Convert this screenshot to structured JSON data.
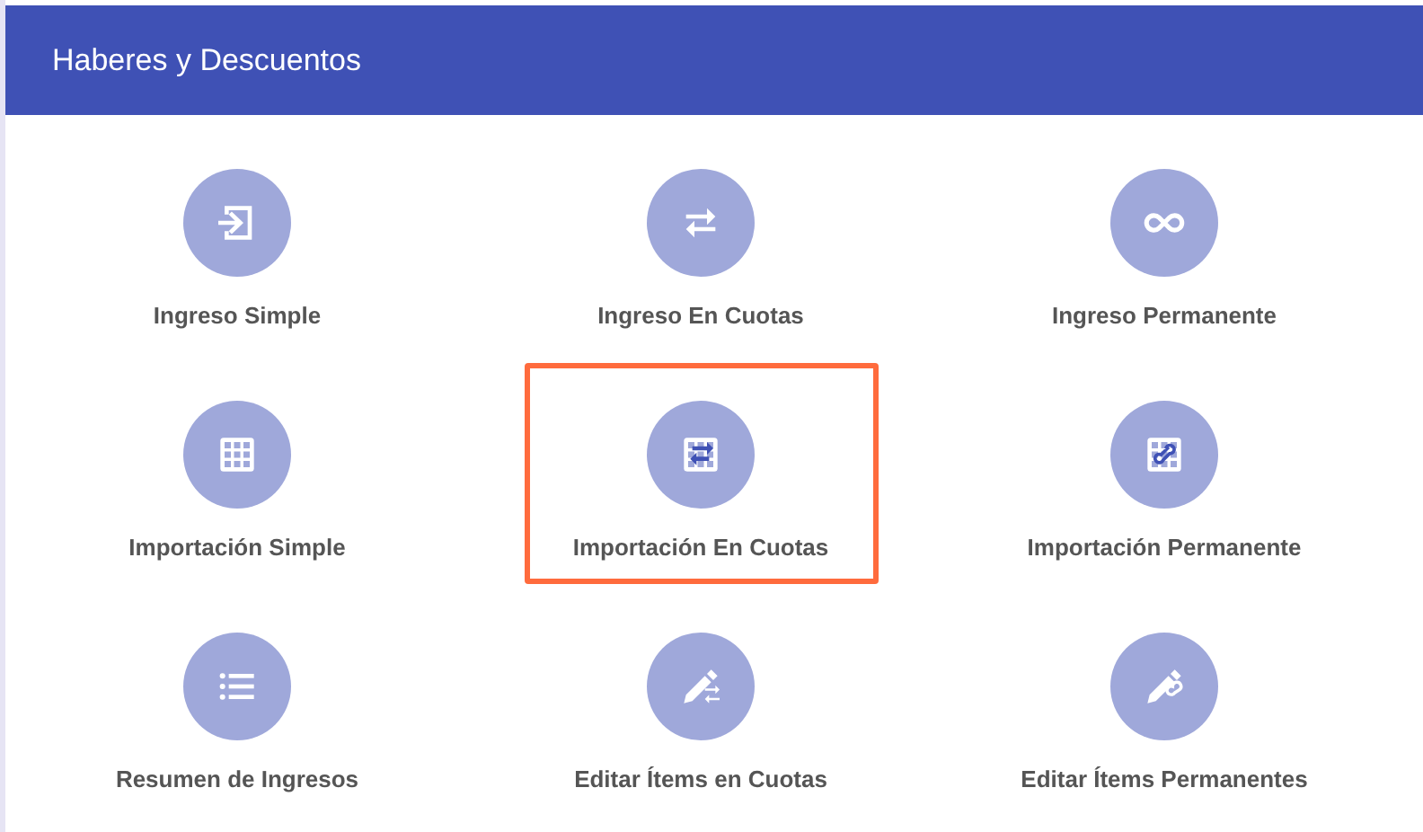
{
  "header": {
    "title": "Haberes y Descuentos"
  },
  "items": [
    {
      "label": "Ingreso Simple",
      "kind": "enter",
      "selected": false
    },
    {
      "label": "Ingreso En Cuotas",
      "kind": "swap",
      "selected": false
    },
    {
      "label": "Ingreso Permanente",
      "kind": "infinity",
      "selected": false
    },
    {
      "label": "Importación Simple",
      "kind": "grid",
      "selected": false
    },
    {
      "label": "Importación En Cuotas",
      "kind": "grid-swap",
      "selected": true
    },
    {
      "label": "Importación Permanente",
      "kind": "grid-infinity",
      "selected": false
    },
    {
      "label": "Resumen de Ingresos",
      "kind": "list",
      "selected": false
    },
    {
      "label": "Editar Ítems en Cuotas",
      "kind": "pencil-swap",
      "selected": false
    },
    {
      "label": "Editar Ítems Permanentes",
      "kind": "pencil-infinity",
      "selected": false
    }
  ]
}
